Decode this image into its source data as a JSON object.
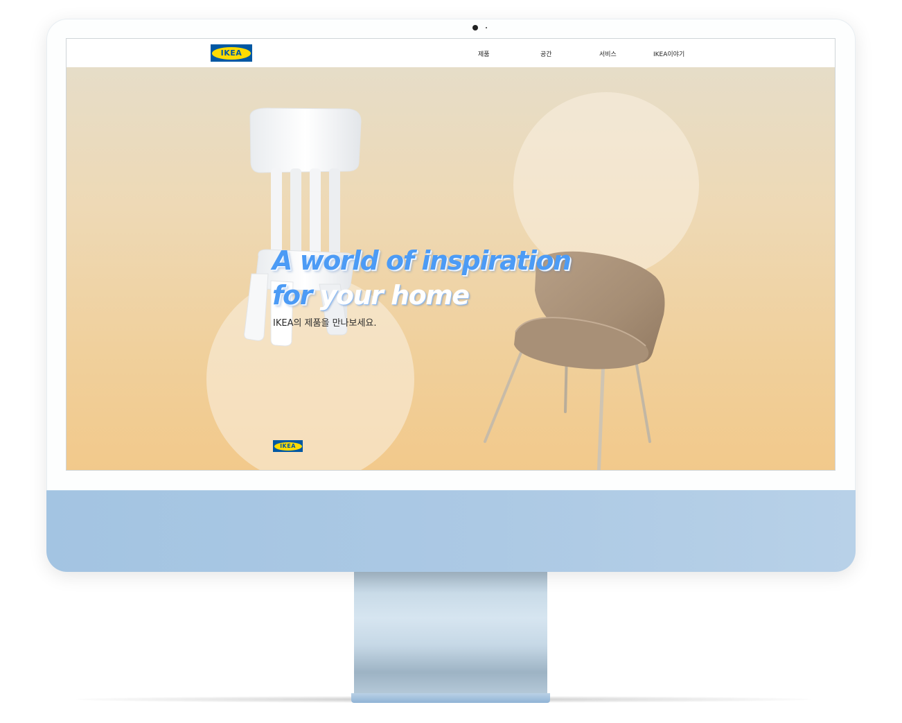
{
  "brand": {
    "logo_text": "IKEA"
  },
  "nav": {
    "items": [
      {
        "label": "제품"
      },
      {
        "label": "공간"
      },
      {
        "label": "서비스"
      },
      {
        "label": "IKEA이야기"
      }
    ]
  },
  "hero": {
    "headline_line1": "A world of inspiration",
    "headline_line2_a": "for ",
    "headline_line2_b": "your",
    "headline_line2_c": " home",
    "subtitle": "IKEA의 제품을 만나보세요.",
    "footer_logo_text": "IKEA"
  },
  "icons": [
    "white-kids-chair-image",
    "beige-upholstered-chair-image",
    "camera-icon"
  ],
  "colors": {
    "ikea_blue": "#0058a3",
    "ikea_yellow": "#ffdb00",
    "headline_blue": "#4c9bf5",
    "hero_gradient_top": "#e6ddc8",
    "hero_gradient_bottom": "#f2c98b",
    "imac_chin": "#a3c4e2"
  }
}
